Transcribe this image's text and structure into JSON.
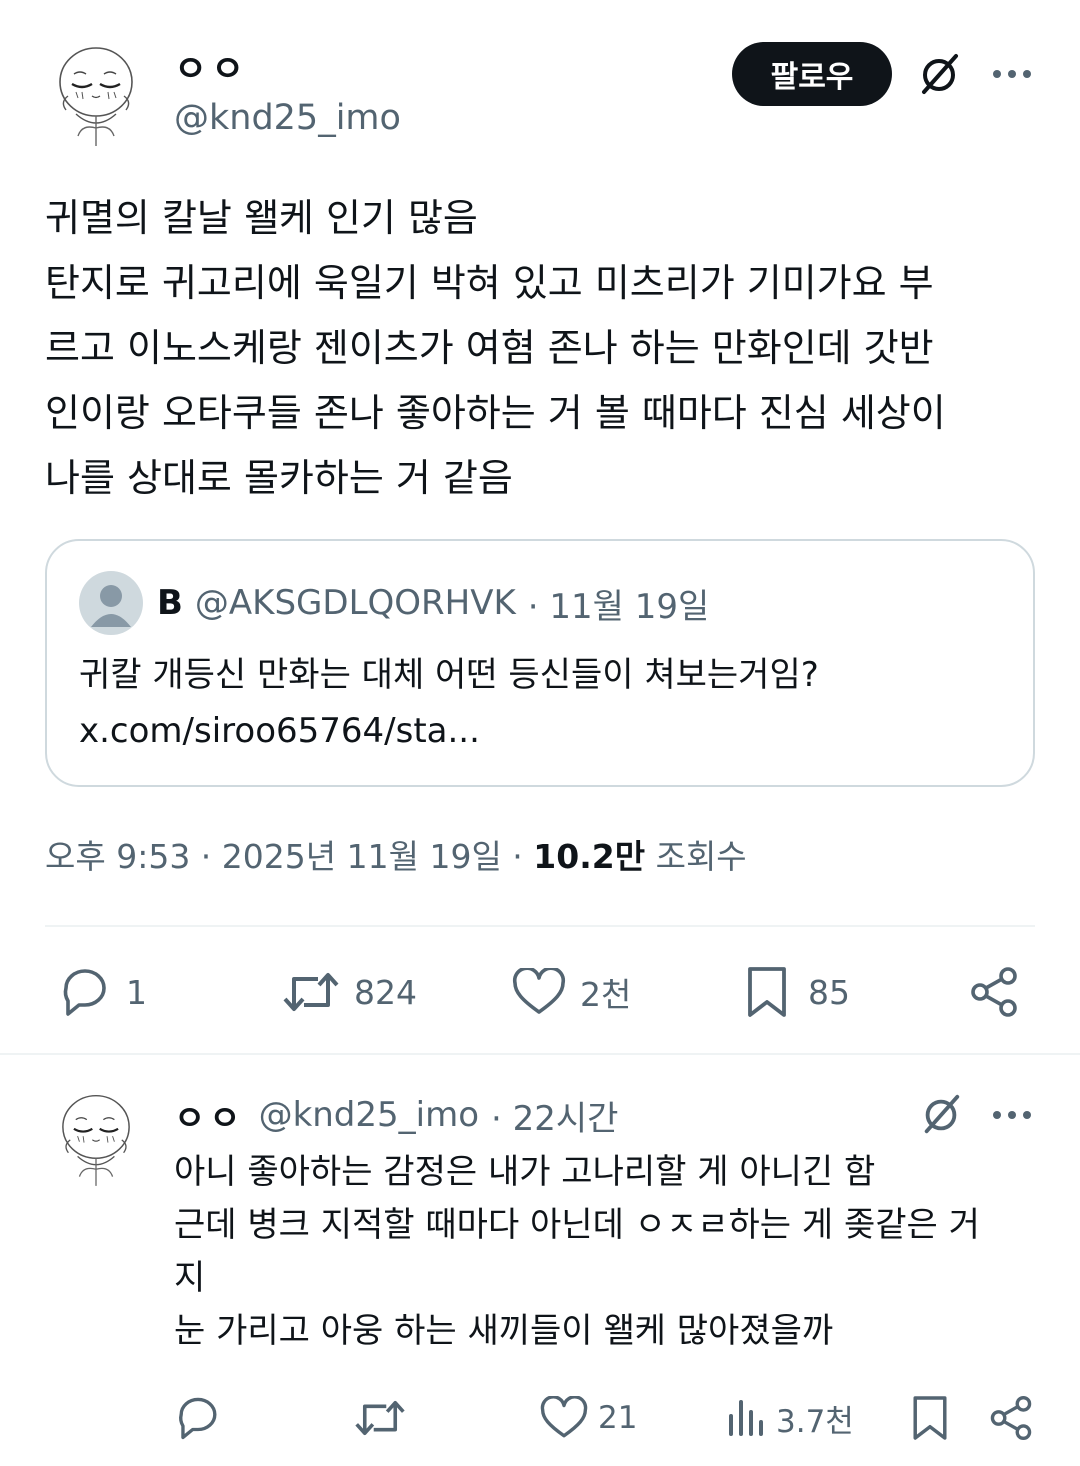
{
  "post": {
    "display_name": "ㅇㅇ",
    "handle": "@knd25_imo",
    "follow_label": "팔로우",
    "body_lines": [
      "귀멸의 칼날 왤케 인기 많음",
      "탄지로 귀고리에 욱일기 박혀 있고 미츠리가 기미가요 부",
      "르고 이노스케랑 젠이츠가 여혐 존나 하는 만화인데 갓반",
      "인이랑 오타쿠들 존나 좋아하는 거 볼 때마다 진심 세상이",
      "나를 상대로 몰카하는 거 같음"
    ],
    "quote": {
      "name": "B",
      "handle": "@AKSGDLQORHVK",
      "date": "· 11월 19일",
      "text": "귀칼 개등신 만화는 대체 어떤 등신들이 쳐보는거임?",
      "link": "x.com/siroo65764/sta..."
    },
    "meta": {
      "time_date": "오후 9:53 · 2025년 11월 19일 ·",
      "views_count": "10.2만",
      "views_label": "조회수"
    },
    "actions": {
      "replies": "1",
      "reposts": "824",
      "likes": "2천",
      "bookmarks": "85"
    }
  },
  "reply": {
    "display_name": "ㅇㅇ",
    "handle": "@knd25_imo",
    "time": "· 22시간",
    "body_lines": [
      "아니 좋아하는 감정은 내가 고나리할 게 아니긴 함",
      "근데 병크 지적할 때마다 아닌데 ㅇㅈㄹ하는 게 좆같은 거",
      "지",
      "눈 가리고 아웅 하는 새끼들이 왤케 많아졌을까"
    ],
    "actions": {
      "likes": "21",
      "views": "3.7천"
    }
  },
  "icons": [
    "avatar-sketch",
    "grok-slash-icon",
    "more-icon",
    "reply-icon",
    "repost-icon",
    "like-icon",
    "bookmark-icon",
    "share-icon",
    "views-icon"
  ],
  "colors": {
    "text": "#0f1419",
    "muted": "#536471",
    "border": "#cfd9de",
    "divider": "#eff3f4",
    "button_bg": "#0f1419"
  }
}
